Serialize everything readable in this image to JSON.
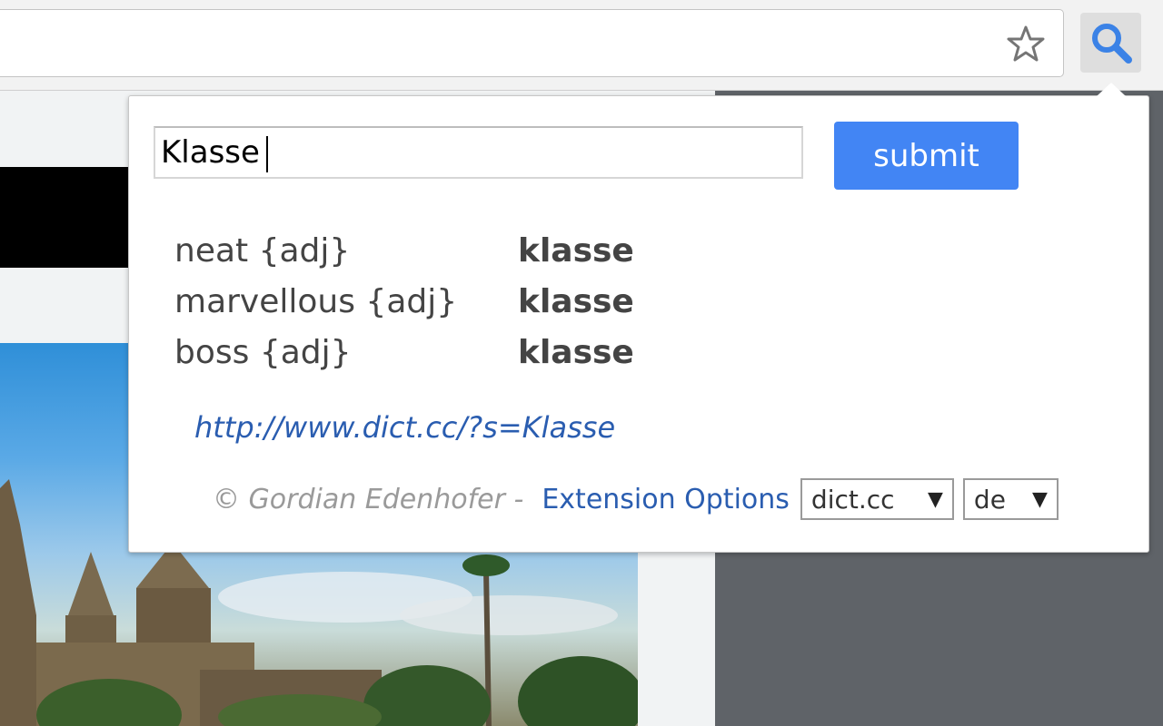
{
  "popup": {
    "search_value": "Klasse",
    "submit_label": "submit",
    "results": [
      {
        "en": "neat {adj}",
        "de": "klasse"
      },
      {
        "en": "marvellous {adj}",
        "de": "klasse"
      },
      {
        "en": "boss {adj}",
        "de": "klasse"
      }
    ],
    "link_text": "http://www.dict.cc/?s=Klasse",
    "footer": {
      "copyright": "© Gordian Edenhofer -",
      "options_label": "Extension Options",
      "dict_select": "dict.cc",
      "lang_select": "de",
      "caret": "▼"
    }
  },
  "colors": {
    "accent": "#4285f4",
    "link": "#2a5db0"
  },
  "icons": {
    "bookmark": "star-icon",
    "extension": "magnifier-icon"
  }
}
